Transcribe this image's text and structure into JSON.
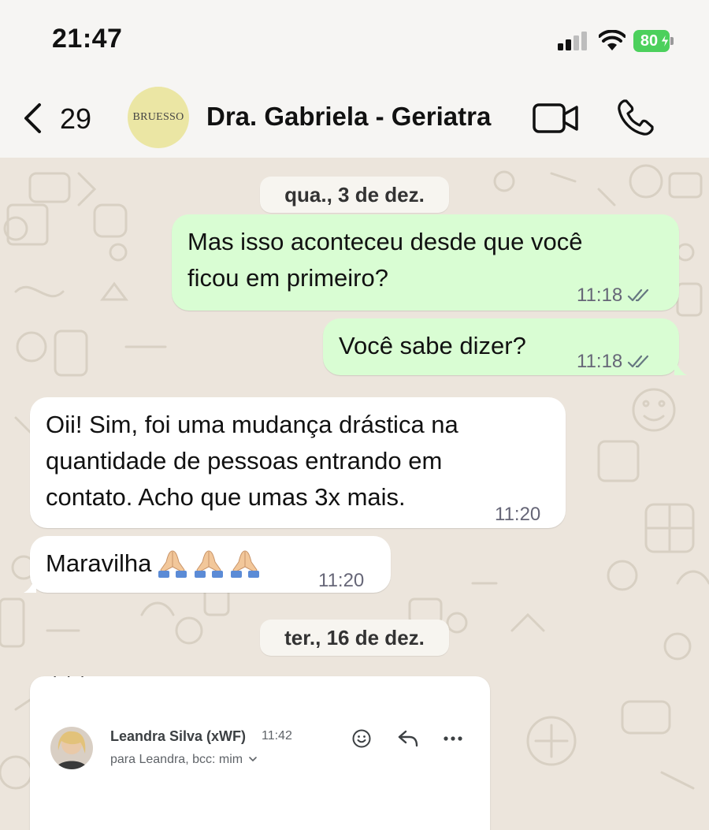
{
  "status_bar": {
    "time": "21:47",
    "battery": "80"
  },
  "header": {
    "unread_count": "29",
    "avatar_text": "BRUESSO",
    "contact_name": "Dra. Gabriela - Geriatra"
  },
  "chat": {
    "date_1": "qua., 3 de dez.",
    "date_2": "ter., 16 de dez.",
    "messages": [
      {
        "direction": "out",
        "text": "Mas isso aconteceu desde que você",
        "text2": "ficou em primeiro?",
        "time": "11:18",
        "status": "read"
      },
      {
        "direction": "out",
        "text": "Você sabe dizer?",
        "time": "11:18",
        "status": "read"
      },
      {
        "direction": "in",
        "text": "Oii! Sim, foi uma mudança drástica na",
        "text2": "quantidade de pessoas entrando em",
        "text3": "contato. Acho que umas 3x mais.",
        "time": "11:20"
      },
      {
        "direction": "in",
        "text": "Maravilha",
        "emoji": [
          "folded-hands",
          "folded-hands",
          "folded-hands"
        ],
        "time": "11:20"
      }
    ]
  },
  "email_card": {
    "sender": "Leandra Silva (xWF)",
    "time": "11:42",
    "recipient": "para Leandra, bcc: mim"
  },
  "colors": {
    "outgoing_bubble": "#d9fdd3",
    "incoming_bubble": "#ffffff",
    "chat_background": "#ece5dc",
    "battery": "#4cd05c",
    "read_ticks": "#667781"
  }
}
